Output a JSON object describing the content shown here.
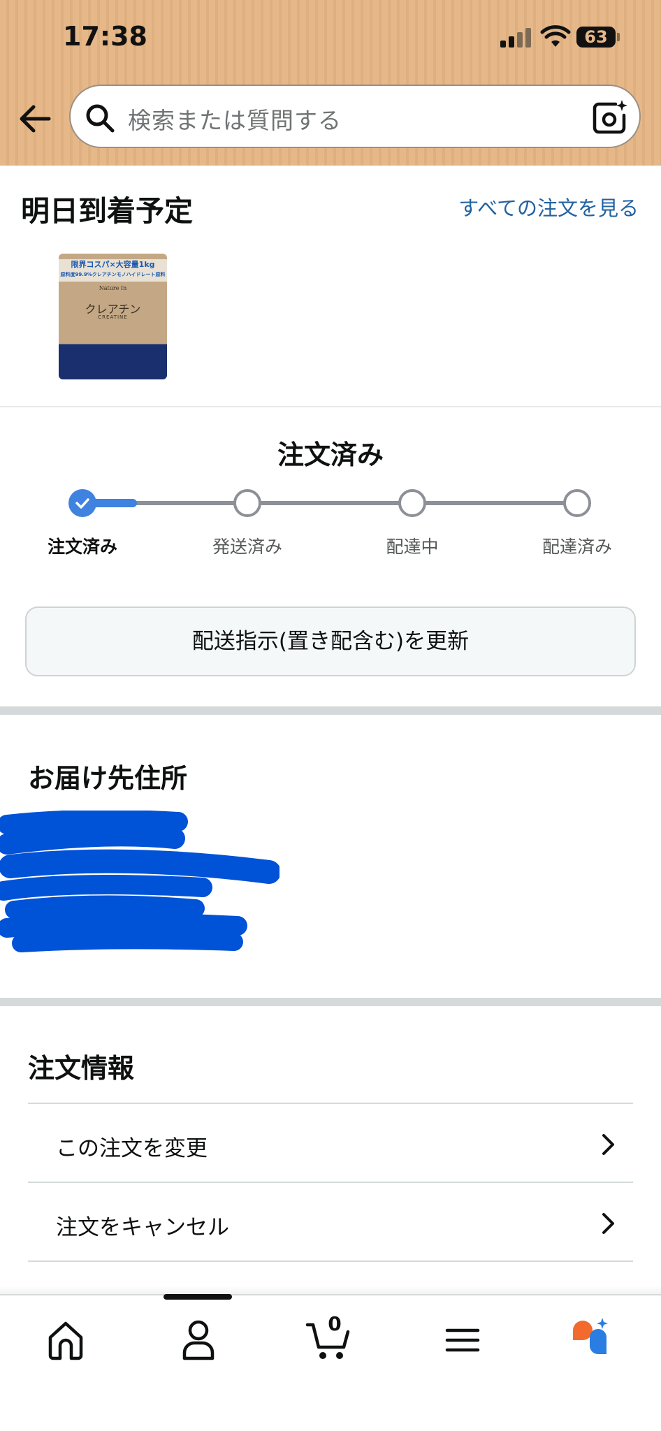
{
  "status_bar": {
    "time": "17:38",
    "battery": "63"
  },
  "search": {
    "placeholder": "検索または質問する"
  },
  "delivery": {
    "title": "明日到着予定",
    "view_all_link": "すべての注文を見る"
  },
  "product": {
    "banner_line1": "限界コスパ×大容量1kg",
    "banner_line2": "原料度99.9%クレアチンモノハイドレート原料",
    "brand": "Nature In",
    "name": "クレアチン",
    "sub": "CREATINE"
  },
  "order_status": {
    "title": "注文済み",
    "steps": [
      {
        "label": "注文済み",
        "state": "done"
      },
      {
        "label": "発送済み",
        "state": "todo"
      },
      {
        "label": "配達中",
        "state": "todo"
      },
      {
        "label": "配達済み",
        "state": "todo"
      }
    ],
    "progress_fraction": 0.11,
    "update_button": "配送指示(置き配含む)を更新"
  },
  "address": {
    "title": "お届け先住所"
  },
  "order_info": {
    "title": "注文情報",
    "rows": [
      {
        "label": "この注文を変更"
      },
      {
        "label": "注文をキャンセル"
      }
    ]
  },
  "bottom_nav": {
    "items": [
      "home-icon",
      "account-icon",
      "cart-icon",
      "menu-icon",
      "rufus-icon"
    ],
    "cart_count": "0"
  },
  "colors": {
    "header_bg": "#e6b889",
    "link": "#2162a1",
    "progress": "#3f82e0",
    "redaction": "#0052d6"
  }
}
